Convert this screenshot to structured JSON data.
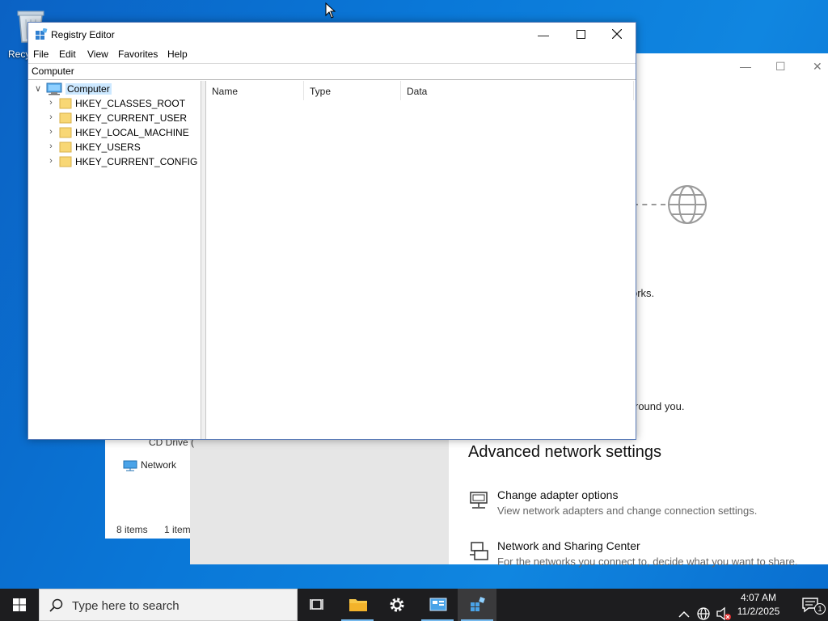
{
  "desktop": {
    "recycle_bin_label": "Recy"
  },
  "regedit": {
    "title": "Registry Editor",
    "menu": [
      "File",
      "Edit",
      "View",
      "Favorites",
      "Help"
    ],
    "address": "Computer",
    "tree": {
      "root": "Computer",
      "children": [
        "HKEY_CLASSES_ROOT",
        "HKEY_CURRENT_USER",
        "HKEY_LOCAL_MACHINE",
        "HKEY_USERS",
        "HKEY_CURRENT_CONFIG"
      ]
    },
    "columns": [
      "Name",
      "Type",
      "Data"
    ]
  },
  "explorer": {
    "cd_drive": "CD Drive (",
    "network": "Network",
    "items_count": "8 items",
    "selected_count": "1 item"
  },
  "settings": {
    "fragment_networks": "orks.",
    "fragment_around": "round you.",
    "advanced_heading": "Advanced network settings",
    "items": [
      {
        "title": "Change adapter options",
        "desc": "View network adapters and change connection settings."
      },
      {
        "title": "Network and Sharing Center",
        "desc": "For the networks you connect to, decide what you want to share."
      }
    ]
  },
  "taskbar": {
    "search_placeholder": "Type here to search",
    "time": "4:07 AM",
    "date": "11/2/2025",
    "notification_count": "1"
  },
  "colors": {
    "desktop_blue": "#0a78d8",
    "taskbar": "#1d1d1f",
    "selection": "#cce8ff",
    "folder_yellow": "#f8d775"
  }
}
